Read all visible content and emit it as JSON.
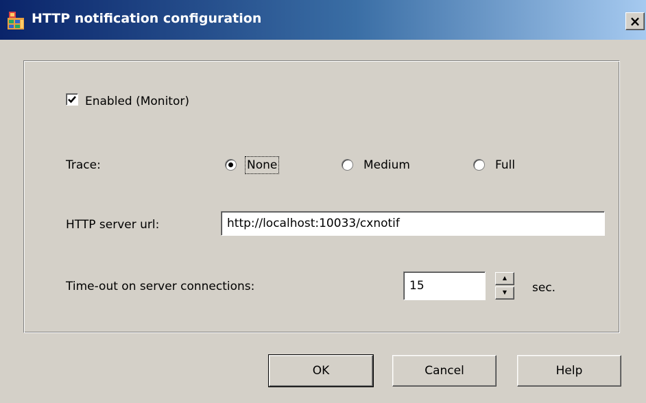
{
  "window": {
    "title": "HTTP notification configuration",
    "close_glyph": "×"
  },
  "icons": {
    "app": "app-config-icon",
    "close": "close-icon",
    "check": "checkmark-icon",
    "spin_up": "arrow-up-icon",
    "spin_down": "arrow-down-icon"
  },
  "enabled": {
    "label": "Enabled (Monitor)",
    "checked": true
  },
  "trace": {
    "label": "Trace:",
    "options": [
      {
        "label": "None",
        "selected": true
      },
      {
        "label": "Medium",
        "selected": false
      },
      {
        "label": "Full",
        "selected": false
      }
    ]
  },
  "server_url": {
    "label": "HTTP server url:",
    "value": "http://localhost:10033/cxnotif"
  },
  "timeout": {
    "label": "Time-out on server connections:",
    "value": "15",
    "unit": "sec.",
    "up_glyph": "▲",
    "down_glyph": "▼"
  },
  "buttons": {
    "ok": "OK",
    "cancel": "Cancel",
    "help": "Help"
  },
  "colors": {
    "face": "#d4d0c8",
    "title_start": "#0a246a",
    "title_end": "#a6caf0"
  }
}
